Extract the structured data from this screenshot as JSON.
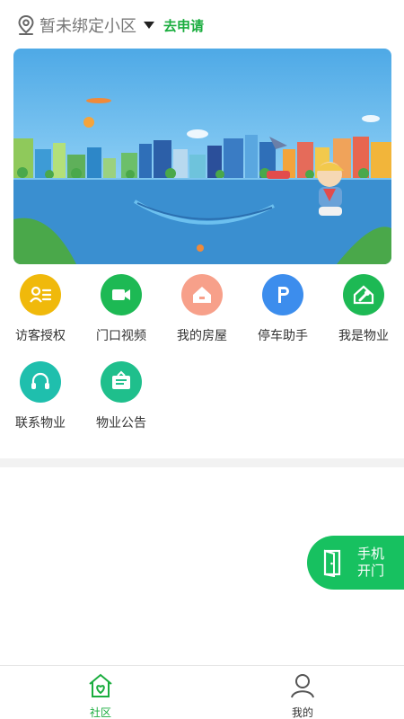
{
  "header": {
    "community_name": "暂未绑定小区",
    "apply_link": "去申请"
  },
  "services": [
    {
      "label": "访客授权",
      "icon": "visitor-icon",
      "color": "#f0b90b"
    },
    {
      "label": "门口视频",
      "icon": "video-icon",
      "color": "#1db954"
    },
    {
      "label": "我的房屋",
      "icon": "house-icon",
      "color": "#f7a08a"
    },
    {
      "label": "停车助手",
      "icon": "parking-icon",
      "color": "#3c8ded"
    },
    {
      "label": "我是物业",
      "icon": "property-wrench-icon",
      "color": "#1db954"
    },
    {
      "label": "联系物业",
      "icon": "headset-icon",
      "color": "#1fbfad"
    },
    {
      "label": "物业公告",
      "icon": "notice-board-icon",
      "color": "#1fbf8c"
    }
  ],
  "floating_button": {
    "label_line1": "手机",
    "label_line2": "开门",
    "color": "#17c160"
  },
  "tabbar": {
    "items": [
      {
        "label": "社区",
        "icon": "community-home-icon",
        "active": true
      },
      {
        "label": "我的",
        "icon": "profile-icon",
        "active": false
      }
    ],
    "active_color": "#1aad3e"
  }
}
